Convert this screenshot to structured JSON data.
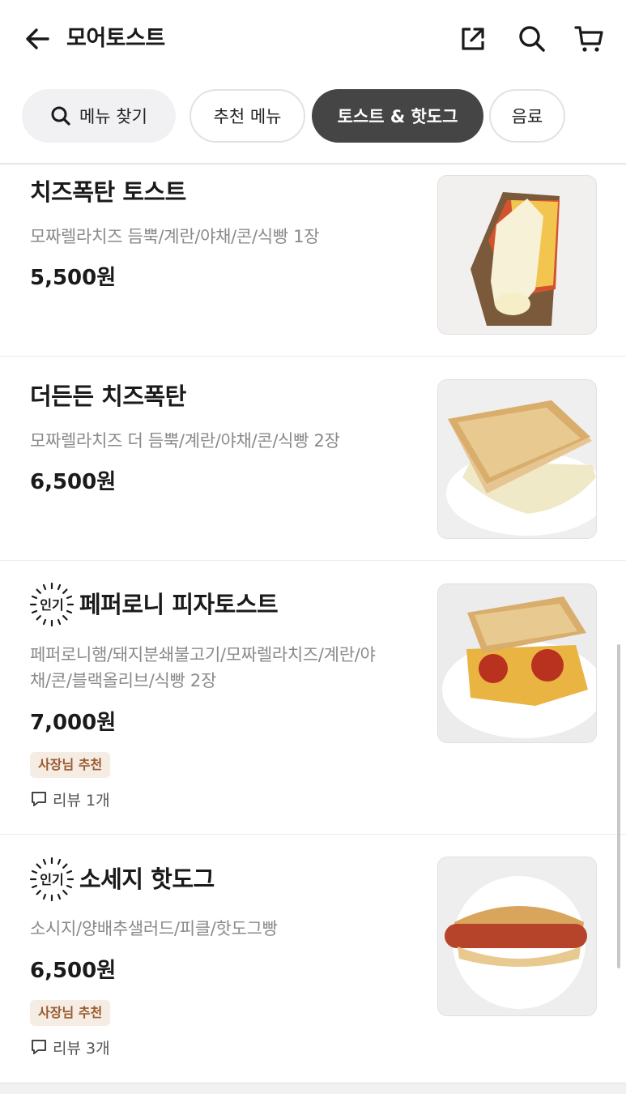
{
  "header": {
    "title": "모어토스트",
    "back_icon": "arrow-left-icon",
    "share_icon": "share-external-icon",
    "search_icon": "search-icon",
    "cart_icon": "cart-icon"
  },
  "chips": {
    "search_label": "메뉴 찾기",
    "tabs": [
      {
        "label": "추천 메뉴",
        "active": false
      },
      {
        "label": "토스트 & 핫도그",
        "active": true
      },
      {
        "label": "음료",
        "active": false
      }
    ]
  },
  "colors": {
    "active_chip": "#454545",
    "owner_badge_bg": "#f5ece4",
    "owner_badge_text": "#9a5a2e",
    "price_text": "#1a1a1a",
    "desc_text": "#8a8a8a"
  },
  "popular_badge_label": "인기",
  "items": [
    {
      "name": "치즈폭탄 토스트",
      "desc": "모짜렐라치즈 듬뿍/계란/야채/콘/식빵 1장",
      "price": "5,500원",
      "popular": false,
      "photo": "cheese-toast-photo"
    },
    {
      "name": "더든든 치즈폭탄",
      "desc": "모짜렐라치즈 더 듬뿍/계란/야채/콘/식빵 2장",
      "price": "6,500원",
      "popular": false,
      "photo": "double-cheese-toast-photo"
    },
    {
      "name": "페퍼로니 피자토스트",
      "desc_line1": "페퍼로니햄/돼지분쇄불고기/모짜렐라치즈/계란/야",
      "desc_line2": "채/콘/블랙올리브/식빵 2장",
      "price": "7,000원",
      "popular": true,
      "owner_badge": "사장님 추천",
      "review": "리뷰 1개",
      "photo": "pepperoni-pizza-toast-photo"
    },
    {
      "name": "소세지 핫도그",
      "desc": "소시지/양배추샐러드/피클/핫도그빵",
      "price": "6,500원",
      "popular": true,
      "owner_badge": "사장님 추천",
      "review": "리뷰 3개",
      "photo": "sausage-hotdog-photo"
    }
  ]
}
